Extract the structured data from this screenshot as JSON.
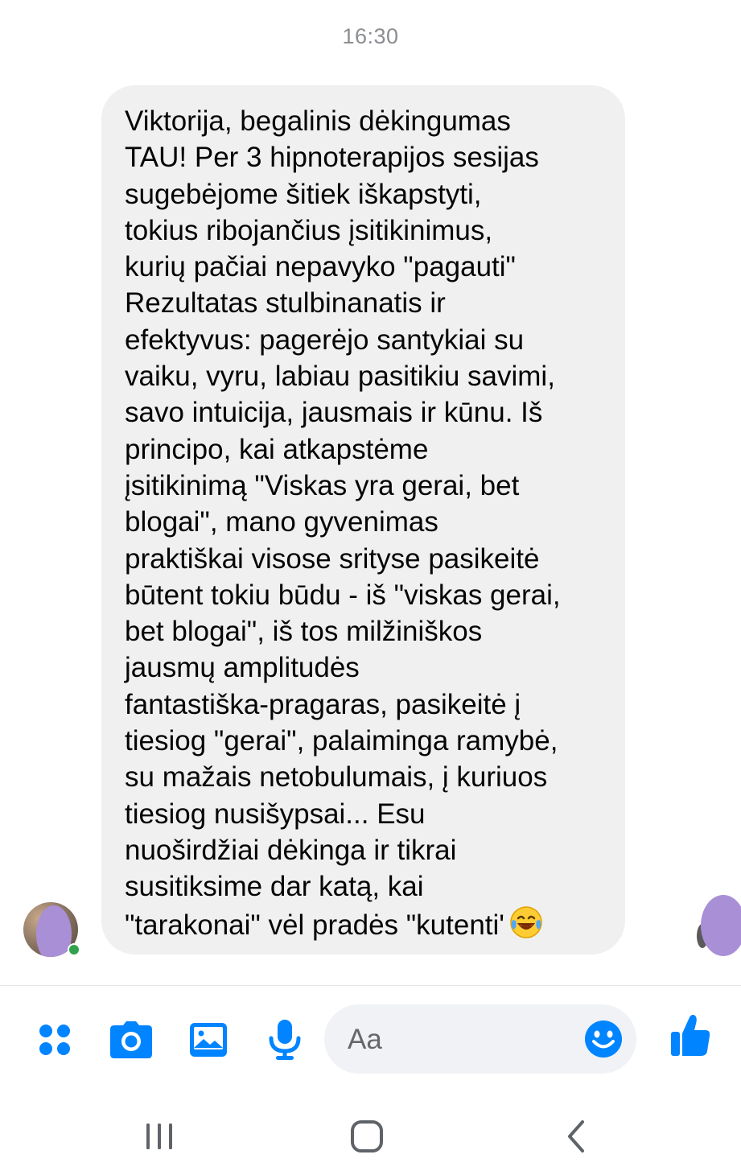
{
  "timestamp": "16:30",
  "message": {
    "lines": [
      "Viktorija, begalinis dėkingumas",
      "TAU! Per 3 hipnoterapijos sesijas",
      "sugebėjome šitiek iškapstyti,",
      "tokius ribojančius įsitikinimus,",
      "kurių pačiai nepavyko \"pagauti\"",
      "Rezultatas stulbinanatis ir",
      "efektyvus: pagerėjo santykiai su",
      "vaiku, vyru, labiau pasitikiu savimi,",
      "savo intuicija, jausmais ir kūnu. Iš",
      "principo, kai atkapstėme",
      "įsitikinimą \"Viskas yra gerai, bet",
      "blogai\", mano gyvenimas",
      "praktiškai visose srityse pasikeitė",
      "būtent tokiu būdu - iš \"viskas gerai,",
      "bet blogai\", iš tos milžiniškos",
      "jausmų amplitudės",
      "fantastiška-pragaras, pasikeitė į",
      "tiesiog \"gerai\", palaiminga ramybė,",
      "su mažais netobulumais, į kuriuos",
      "tiesiog nusišypsai... Esu",
      "nuoširdžiai dėkinga ir tikrai",
      "susitiksime dar katą, kai",
      "\"tarakonai\" vėl pradės \"kutenti'"
    ],
    "trailing_emoji": "face-with-tears-of-joy"
  },
  "composer": {
    "placeholder": "Aa",
    "icons": [
      "apps-icon",
      "camera-icon",
      "gallery-icon",
      "microphone-icon",
      "emoji-icon",
      "thumbs-up-icon"
    ]
  },
  "colors": {
    "accent": "#0084ff",
    "bubble": "#f0f0f0",
    "timestamp": "#8a8d91",
    "text": "#050505",
    "nav_icon": "#5f6368"
  },
  "nav": [
    "recent-apps-icon",
    "home-icon",
    "back-icon"
  ]
}
